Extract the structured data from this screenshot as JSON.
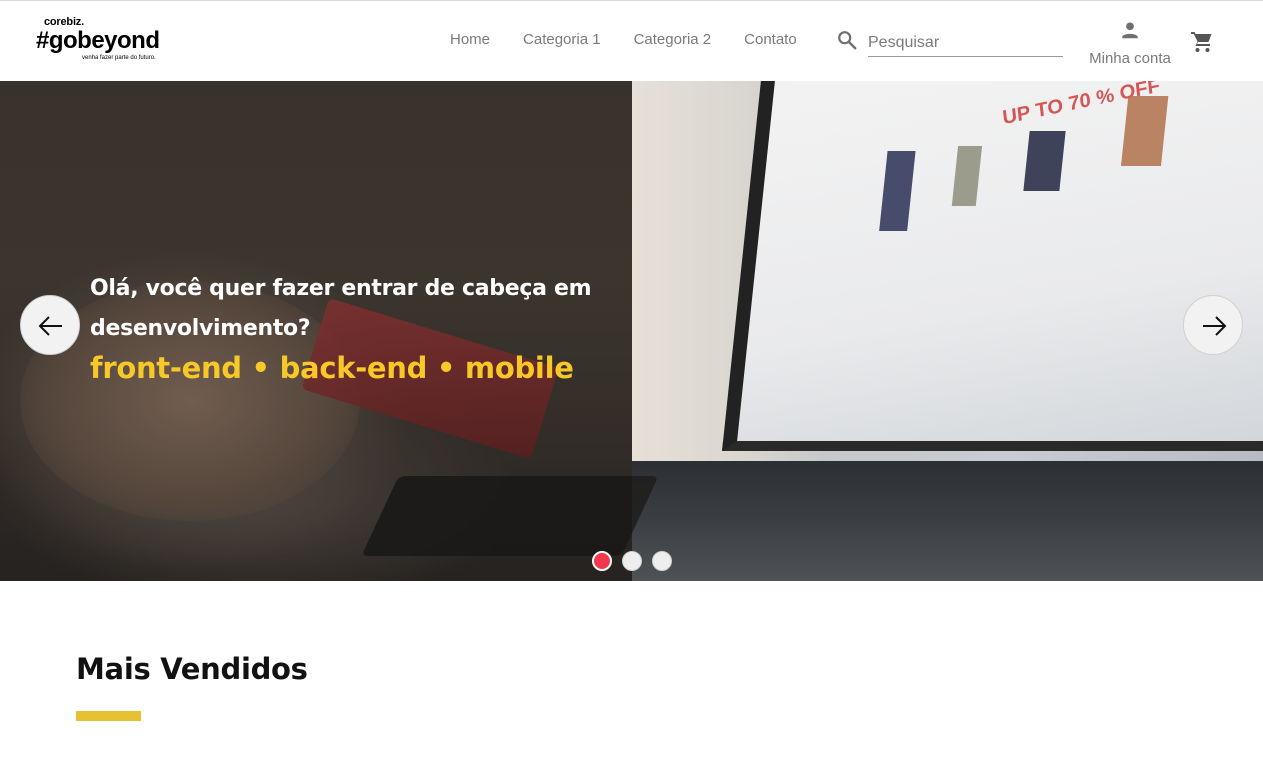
{
  "brand": {
    "top": "corebiz.",
    "main": "#gobeyond",
    "tagline": "venha fazer parte do futuro."
  },
  "nav": {
    "items": [
      {
        "label": "Home"
      },
      {
        "label": "Categoria 1"
      },
      {
        "label": "Categoria 2"
      },
      {
        "label": "Contato"
      }
    ]
  },
  "search": {
    "icon": "search-icon",
    "value": "",
    "placeholder": "Pesquisar"
  },
  "account": {
    "icon": "person-icon",
    "label": "Minha conta"
  },
  "cart": {
    "icon": "shopping-cart-icon"
  },
  "hero": {
    "headline_line1": "Olá, você quer fazer entrar de cabeça em",
    "headline_line2": "desenvolvimento?",
    "tags": "front-end • back-end • mobile",
    "tags_color": "#f8c829",
    "promo_text": "UP TO 70 % OFF",
    "slides": 3,
    "active_slide": 1,
    "active_dot_color": "#f3384e"
  },
  "section": {
    "title": "Mais Vendidos",
    "accent_color": "#e6c233"
  }
}
